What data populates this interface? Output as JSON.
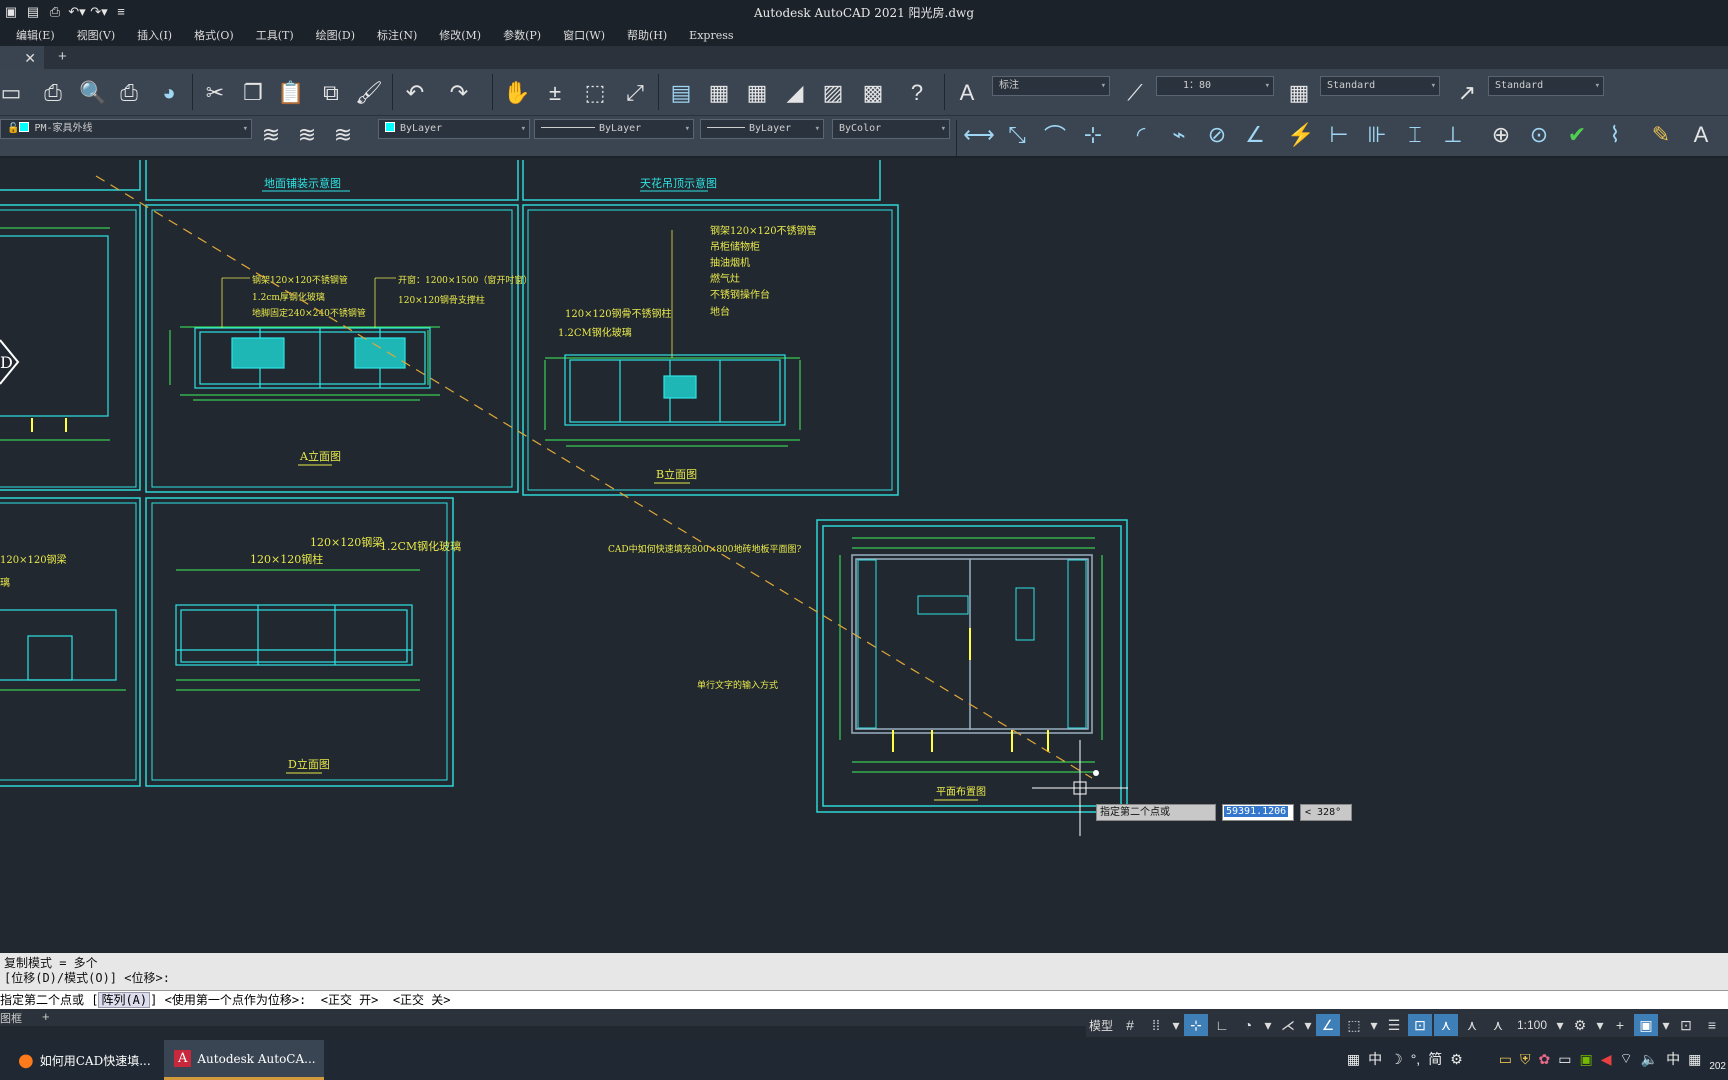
{
  "window": {
    "title": "Autodesk AutoCAD 2021    阳光房.dwg"
  },
  "menu": [
    "编辑(E)",
    "视图(V)",
    "插入(I)",
    "格式(O)",
    "工具(T)",
    "绘图(D)",
    "标注(N)",
    "修改(M)",
    "参数(P)",
    "窗口(W)",
    "帮助(H)",
    "Express"
  ],
  "toolbar": {
    "dim_style": "标注",
    "scale": "1：80",
    "table_style": "Standard",
    "mleader_style": "Standard",
    "layer": "PM-家具外线",
    "color": "ByLayer",
    "linetype": "ByLayer",
    "lineweight": "ByLayer",
    "plotstyle": "ByColor"
  },
  "drawing": {
    "labels": {
      "top1": "地面铺装示意图",
      "top2": "天花吊顶示意图",
      "elevA": "A立面图",
      "elevB": "B立面图",
      "elevD": "D立面图",
      "plan": "平面布置图",
      "a1": "钢架120×120不锈钢管",
      "a2": "1.2cm厚钢化玻璃",
      "a3": "地脚固定240×240不锈钢管",
      "a4": "开窗：1200×1500（窗开吋窗）",
      "a5": "120×120钢骨支撑柱",
      "b1": "钢架120×120不锈钢管",
      "b2": "吊柜储物柜",
      "b3": "抽油烟机",
      "b4": "燃气灶",
      "b5": "不锈钢操作台",
      "b6": "地台",
      "b7": "120×120钢骨不锈钢柱",
      "b8": "1.2CM钢化玻璃",
      "d1": "120×120钢梁",
      "d2": "120×120钢柱",
      "d3": "1.2CM钢化玻璃",
      "left1": "120×120钢梁",
      "left2": "璃",
      "q": "CAD中如何快速填充800×800地砖地板平面图?",
      "q2": "单行文字的输入方式"
    }
  },
  "dynamic_input": {
    "prompt": "指定第二个点或",
    "distance": "59391.1206",
    "angle": "< 328°"
  },
  "command": {
    "line1": "复制模式 = 多个",
    "line2": "[位移(D)/模式(O)] <位移>:",
    "input_prefix": "指定第二个点或 [",
    "input_highlight": "阵列(A)",
    "input_suffix": "] <使用第一个点作为位移>:  <正交 开>  <正交 关>"
  },
  "layout_tabs": {
    "current": "图框"
  },
  "status": {
    "model": "模型",
    "scale": "1:100"
  },
  "taskbar": {
    "t1": "如何用CAD快速填...",
    "t2": "Autodesk AutoCA..."
  },
  "tray": {
    "ime": "中",
    "ime2": "简",
    "lang": "中",
    "date_frag": "202"
  }
}
